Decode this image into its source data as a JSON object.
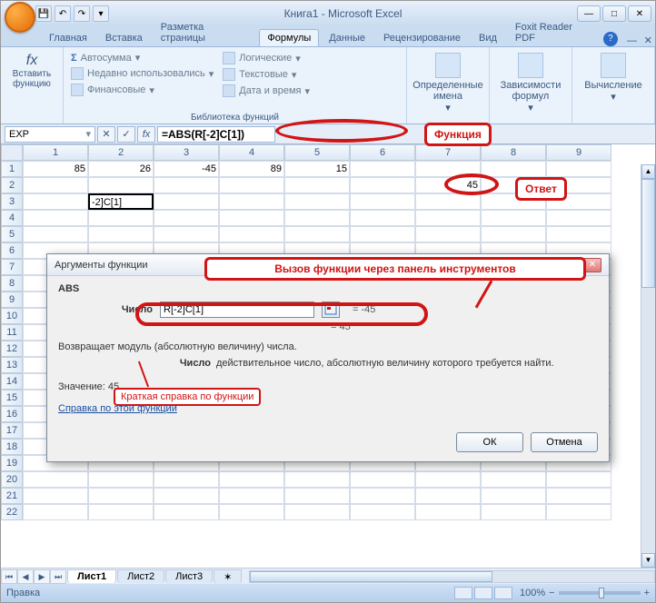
{
  "app": {
    "title": "Книга1 - Microsoft Excel"
  },
  "tabs": {
    "items": [
      "Главная",
      "Вставка",
      "Разметка страницы",
      "Формулы",
      "Данные",
      "Рецензирование",
      "Вид",
      "Foxit Reader PDF"
    ],
    "active_index": 3
  },
  "ribbon": {
    "insert_fn": {
      "label": "Вставить\nфункцию",
      "fx": "fx"
    },
    "library": {
      "group_label": "Библиотека функций",
      "col1": [
        "Автосумма",
        "Недавно использовались",
        "Финансовые"
      ],
      "col2": [
        "Логические",
        "Текстовые",
        "Дата и время"
      ]
    },
    "names": {
      "label": "Определенные\nимена"
    },
    "deps": {
      "label": "Зависимости\nформул"
    },
    "calc": {
      "label": "Вычисление"
    }
  },
  "formula_bar": {
    "name_box": "EXP",
    "cancel": "✕",
    "enter": "✓",
    "fx": "fx",
    "formula": "=ABS(R[-2]C[1])"
  },
  "columns": [
    "1",
    "2",
    "3",
    "4",
    "5",
    "6",
    "7",
    "8",
    "9"
  ],
  "grid": {
    "rows": [
      "1",
      "2",
      "3",
      "4",
      "5",
      "6",
      "7",
      "8",
      "9",
      "10",
      "11",
      "12",
      "13",
      "14",
      "15",
      "16",
      "17",
      "18",
      "19",
      "20",
      "21",
      "22"
    ],
    "cells": {
      "r1": [
        "85",
        "26",
        "-45",
        "89",
        "15",
        "",
        "",
        "",
        ""
      ],
      "r2": [
        "",
        "",
        "",
        "",
        "",
        "",
        "45",
        "",
        ""
      ],
      "r3": [
        "",
        "-2]C[1]",
        "",
        "",
        "",
        "",
        "",
        "",
        ""
      ]
    }
  },
  "annotations": {
    "function": "Функция",
    "answer": "Ответ",
    "panel_call": "Вызов функции через панель инструментов",
    "brief_help": "Краткая справка по функции"
  },
  "dialog": {
    "title": "Аргументы функции",
    "fn_name": "ABS",
    "arg_label": "Число",
    "arg_value": "R[-2]C[1]",
    "arg_result": "= -45",
    "result": "= 45",
    "description": "Возвращает модуль (абсолютную величину) числа.",
    "arg_name": "Число",
    "arg_desc": "действительное число, абсолютную величину которого требуется найти.",
    "value_label": "Значение:",
    "value": "45",
    "help_link": "Справка по этой функции",
    "ok": "ОК",
    "cancel": "Отмена"
  },
  "sheet_tabs": {
    "active": "Лист1",
    "others": [
      "Лист2",
      "Лист3"
    ]
  },
  "status": {
    "mode": "Правка",
    "zoom": "100%",
    "zoom_minus": "−",
    "zoom_plus": "+"
  }
}
